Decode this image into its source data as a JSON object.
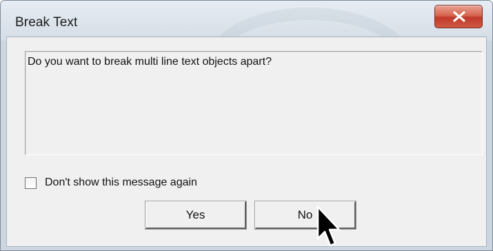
{
  "window": {
    "title": "Break Text",
    "close_icon": "close-x-icon",
    "close_button_color": "#c9432f"
  },
  "message": {
    "text": "Do you want to break multi line text objects apart?"
  },
  "checkbox": {
    "label": "Don't show this message again",
    "checked": false
  },
  "buttons": {
    "yes_label": "Yes",
    "no_label": "No"
  },
  "cursor": {
    "icon": "arrow-cursor-icon"
  }
}
